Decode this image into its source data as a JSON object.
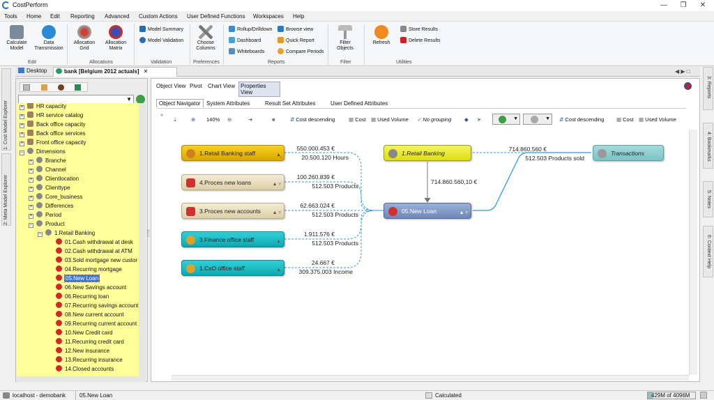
{
  "app": {
    "title": "CostPerform"
  },
  "menu": [
    "Tools",
    "Home",
    "Edit",
    "Reporting",
    "Advanced",
    "Custom Actions",
    "User Defined Functions",
    "Workspaces",
    "Help"
  ],
  "ribbon": {
    "calculate_model": "Calculate\nModel",
    "data_transmission": "Data\nTransmission",
    "allocation_grid": "Allocation\nGrid",
    "allocation_matrix": "Allocation\nMatrix",
    "model_summary": "Model Summary",
    "model_validation": "Model Validation",
    "choose_columns": "Choose\nColumns",
    "rollup": "Rollup/Drilldown",
    "dashboard": "Dashboard",
    "whiteboards": "Whiteboards",
    "browse_view": "Browse view",
    "quick_report": "Quick Report",
    "compare_periods": "Compare Periods",
    "filter_objects": "Filter\nObjects",
    "refresh": "Refresh",
    "store_results": "Store Results",
    "delete_results": "Delete Results",
    "groups": [
      "Edit",
      "Allocations",
      "Validation",
      "Preferences",
      "Reports",
      "Filter",
      "Utilities"
    ]
  },
  "tabs": {
    "desktop": "Desktop",
    "model": "bank [Belgium 2012 actuals]"
  },
  "side_tabs_left": [
    "1: Cost Model Explorer",
    "2: Meta Model Explorer"
  ],
  "side_tabs_right": [
    "3: Reports",
    "4: Bookmarks",
    "5: Notes",
    "6: Context Help"
  ],
  "tree": {
    "items": [
      "HR capacity",
      "HR service catalog",
      "Back office capacity",
      "Back office services",
      "Front office capacity",
      "Dimensions",
      "Branche",
      "Channel",
      "Clientlocation",
      "Clienttype",
      "Core_business",
      "Differences",
      "Period",
      "Product",
      "1.Retail Banking",
      "01.Cash withdrawal at desk",
      "02.Cash withdrawal at ATM",
      "03.Sold mortgage new custor",
      "04.Recurring mortgage",
      "05.New Loan",
      "06.New Savings account",
      "06.Recurring loan",
      "07.Recurring savings account",
      "08.New current account",
      "09.Recurring current account",
      "10.New Credit card",
      "11.Recurring credit card",
      "12.New insurance",
      "13.Recurring insurance",
      "14.Closed accounts"
    ]
  },
  "view_tabs": [
    "Object View",
    "Pivot",
    "Chart View",
    "Properties View"
  ],
  "sub_tabs": [
    "Object Navigator",
    "System Attributes",
    "Result Set Attributes",
    "User Defined Attributes"
  ],
  "toolbar": {
    "zoom": "140%",
    "sort1": "Cost descending",
    "cost1": "Cost",
    "vol1": "Used Volume",
    "grouping": "No grouping",
    "sort2": "Cost descending",
    "cost2": "Cost",
    "vol2": "Used Volume"
  },
  "nodes": {
    "n1": {
      "label": "1.Retail Banking staff",
      "v1": "550.000.453 €",
      "v2": "20.500.120 Hours"
    },
    "n2": {
      "label": "4.Proces new loans",
      "v1": "100.260.839 €",
      "v2": "512.503 Products"
    },
    "n3": {
      "label": "3.Proces new accounts",
      "v1": "62.663.024 €",
      "v2": "512.503 Products"
    },
    "n4": {
      "label": "3.Finance office staff",
      "v1": "1.911.576 €",
      "v2": "512.503 Products"
    },
    "n5": {
      "label": "1.CxO office staff",
      "v1": "24.667 €",
      "v2": "309.375.003 Income"
    },
    "center": {
      "label": "05.New Loan"
    },
    "parent": {
      "label": "1.Retail Banking",
      "v": "714.860.560,10 €"
    },
    "transactions": {
      "label": "Transactions",
      "v1": "714.860.560 €",
      "v2": "512.503 Products sold"
    }
  },
  "status": {
    "server": "localhost - demobank",
    "selection": "05.New Loan",
    "state": "Calculated",
    "memory": "429M of 4096M"
  },
  "colors": {
    "tree_bg": "#ffff99",
    "gold": "#e8b800",
    "beige": "#ece3c8",
    "teal": "#18b8c0",
    "blue": "#7e96c4",
    "yellow": "#ecec20",
    "line": "#2c9be0"
  }
}
